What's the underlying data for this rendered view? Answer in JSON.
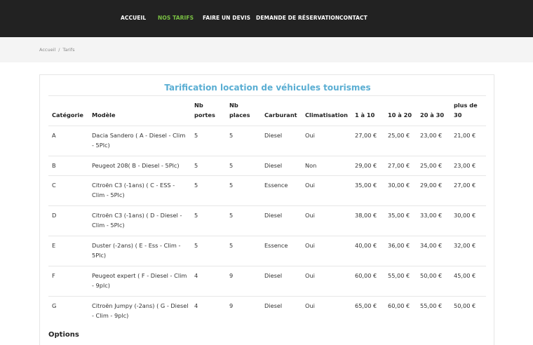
{
  "nav": {
    "items": [
      {
        "label": "ACCUEIL",
        "active": false
      },
      {
        "label": "NOS TARIFS",
        "active": true
      },
      {
        "label": "FAIRE UN DEVIS",
        "active": false
      },
      {
        "label": "DEMANDE DE RÉSERVATION",
        "active": false
      },
      {
        "label": "CONTACT",
        "active": false
      }
    ],
    "active_color": "#7ac143"
  },
  "breadcrumb": {
    "home": "Accueil",
    "separator": "/",
    "current": "Tarifs"
  },
  "table": {
    "title": "Tarification location de véhicules tourismes",
    "title_color": "#5aaed3",
    "headers": {
      "categorie": "Catégorie",
      "modele": "Modèle",
      "portes": "Nb portes",
      "places": "Nb places",
      "carburant": "Carburant",
      "climatisation": "Climatisation",
      "p1": "1 à 10",
      "p2": "10 à 20",
      "p3": "20 à 30",
      "p4": "plus de 30"
    },
    "rows": [
      {
        "categorie": "A",
        "modele": "Dacia Sandero ( A - Diesel - Clim - 5Plc)",
        "portes": "5",
        "places": "5",
        "carburant": "Diesel",
        "climatisation": "Oui",
        "p1": "27,00 €",
        "p2": "25,00 €",
        "p3": "23,00 €",
        "p4": "21,00 €"
      },
      {
        "categorie": "B",
        "modele": "Peugeot 208( B - Diesel - 5Plc)",
        "portes": "5",
        "places": "5",
        "carburant": "Diesel",
        "climatisation": "Non",
        "p1": "29,00 €",
        "p2": "27,00 €",
        "p3": "25,00 €",
        "p4": "23,00 €"
      },
      {
        "categorie": "C",
        "modele": "Citroën C3 (-1ans) ( C - ESS - Clim - 5Plc)",
        "portes": "5",
        "places": "5",
        "carburant": "Essence",
        "climatisation": "Oui",
        "p1": "35,00 €",
        "p2": "30,00 €",
        "p3": "29,00 €",
        "p4": "27,00 €"
      },
      {
        "categorie": "D",
        "modele": "Citroën C3 (-1ans) ( D - Diesel - Clim - 5Plc)",
        "portes": "5",
        "places": "5",
        "carburant": "Diesel",
        "climatisation": "Oui",
        "p1": "38,00 €",
        "p2": "35,00 €",
        "p3": "33,00 €",
        "p4": "30,00 €"
      },
      {
        "categorie": "E",
        "modele": "Duster (-2ans) ( E - Ess - Clim - 5Plc)",
        "portes": "5",
        "places": "5",
        "carburant": "Essence",
        "climatisation": "Oui",
        "p1": "40,00 €",
        "p2": "36,00 €",
        "p3": "34,00 €",
        "p4": "32,00 €"
      },
      {
        "categorie": "F",
        "modele": "Peugeot expert ( F - Diesel - Clim - 9plc)",
        "portes": "4",
        "places": "9",
        "carburant": "Diesel",
        "climatisation": "Oui",
        "p1": "60,00 €",
        "p2": "55,00 €",
        "p3": "50,00 €",
        "p4": "45,00 €"
      },
      {
        "categorie": "G",
        "modele": "Citroën Jumpy (-2ans) ( G - Diesel - Clim - 9plc)",
        "portes": "4",
        "places": "9",
        "carburant": "Diesel",
        "climatisation": "Oui",
        "p1": "65,00 €",
        "p2": "60,00 €",
        "p3": "55,00 €",
        "p4": "50,00 €"
      }
    ]
  },
  "options": {
    "title": "Options"
  }
}
